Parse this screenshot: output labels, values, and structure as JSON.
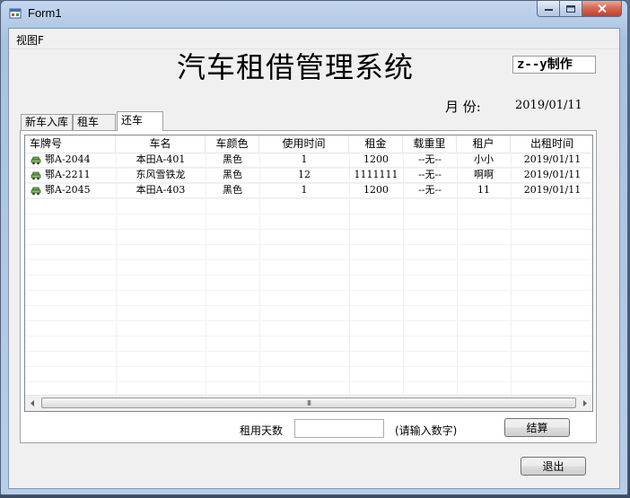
{
  "window": {
    "title": "Form1"
  },
  "menu": {
    "items": [
      "视图F"
    ]
  },
  "header": {
    "system_title": "汽车租借管理系统",
    "author": "z--y制作",
    "month_label": "月  份:",
    "month_value": "2019/01/11"
  },
  "tabs": [
    {
      "label": "新车入库",
      "active": false
    },
    {
      "label": "租车",
      "active": false
    },
    {
      "label": "还车",
      "active": true
    }
  ],
  "table": {
    "columns": [
      "车牌号",
      "车名",
      "车颜色",
      "使用时间",
      "租金",
      "载重里",
      "租户",
      "出租时间"
    ],
    "rows": [
      [
        "鄂A-2044",
        "本田A-401",
        "黑色",
        "1",
        "1200",
        "--无--",
        "小小",
        "2019/01/11"
      ],
      [
        "鄂A-2211",
        "东风雪铁龙",
        "黑色",
        "12",
        "1111111",
        "--无--",
        "啊啊",
        "2019/01/11"
      ],
      [
        "鄂A-2045",
        "本田A-403",
        "黑色",
        "1",
        "1200",
        "--无--",
        "11",
        "2019/01/11"
      ]
    ]
  },
  "scrollbar": {
    "thumb_grip": "III"
  },
  "rental": {
    "days_label": "租用天数",
    "days_value": "",
    "hint": "(请输入数字)",
    "settle_label": "结算"
  },
  "footer": {
    "exit_label": "退出"
  },
  "colors": {
    "accent": "#0a246a",
    "close_button": "#c0412a"
  }
}
